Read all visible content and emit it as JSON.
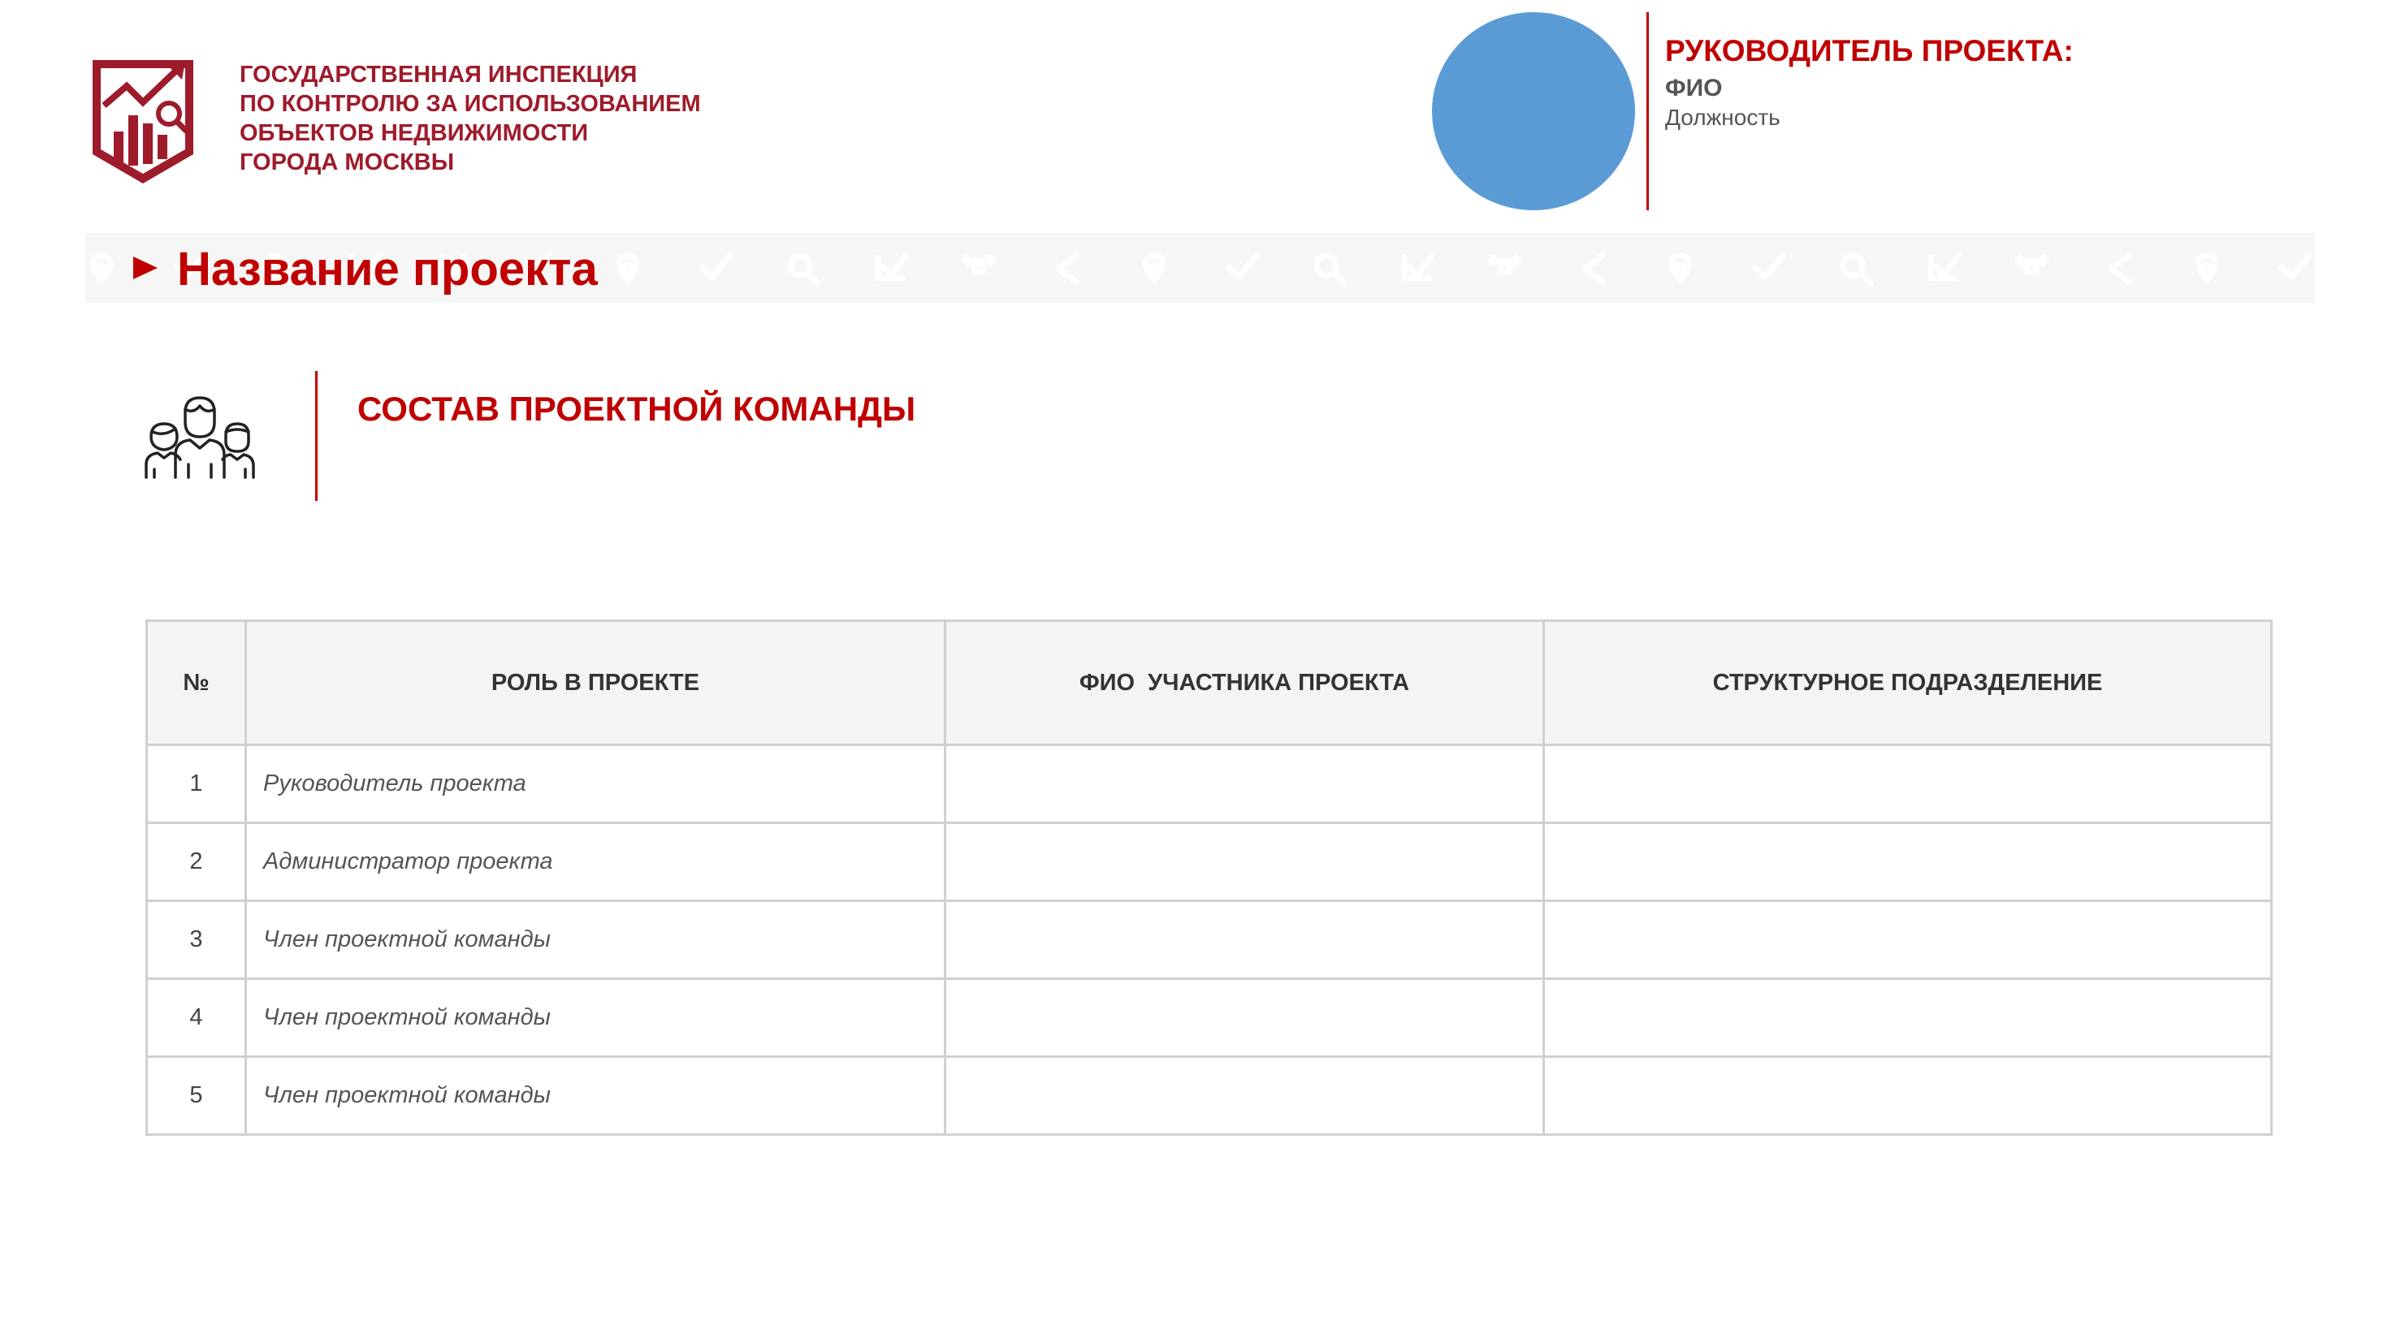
{
  "organization": {
    "name_lines": [
      "ГОСУДАРСТВЕННАЯ ИНСПЕКЦИЯ",
      "ПО КОНТРОЛЮ ЗА ИСПОЛЬЗОВАНИЕМ",
      "ОБЪЕКТОВ НЕДВИЖИМОСТИ",
      "ГОРОДА МОСКВЫ"
    ]
  },
  "project_manager": {
    "title": "РУКОВОДИТЕЛЬ ПРОЕКТА:",
    "fio": "ФИО",
    "position": "Должность"
  },
  "project": {
    "name": "Название проекта"
  },
  "section": {
    "title": "СОСТАВ ПРОЕКТНОЙ КОМАНДЫ"
  },
  "table": {
    "headers": [
      "№",
      "РОЛЬ В ПРОЕКТЕ",
      "ФИО  УЧАСТНИКА ПРОЕКТА",
      "СТРУКТУРНОЕ ПОДРАЗДЕЛЕНИЕ"
    ],
    "rows": [
      {
        "num": "1",
        "role": "Руководитель проекта",
        "fio": "",
        "department": ""
      },
      {
        "num": "2",
        "role": "Администратор проекта",
        "fio": "",
        "department": ""
      },
      {
        "num": "3",
        "role": "Член проектной команды",
        "fio": "",
        "department": ""
      },
      {
        "num": "4",
        "role": "Член проектной команды",
        "fio": "",
        "department": ""
      },
      {
        "num": "5",
        "role": "Член проектной команды",
        "fio": "",
        "department": ""
      }
    ]
  },
  "colors": {
    "accent_red": "#c00000",
    "logo_red": "#9e1b2b",
    "photo_placeholder": "#5b9bd5",
    "table_border": "#d0d0d0",
    "table_header_bg": "#f4f4f4"
  },
  "icons": [
    "logo-emblem-icon",
    "play-arrow-icon",
    "team-people-icon",
    "banner-pattern"
  ]
}
